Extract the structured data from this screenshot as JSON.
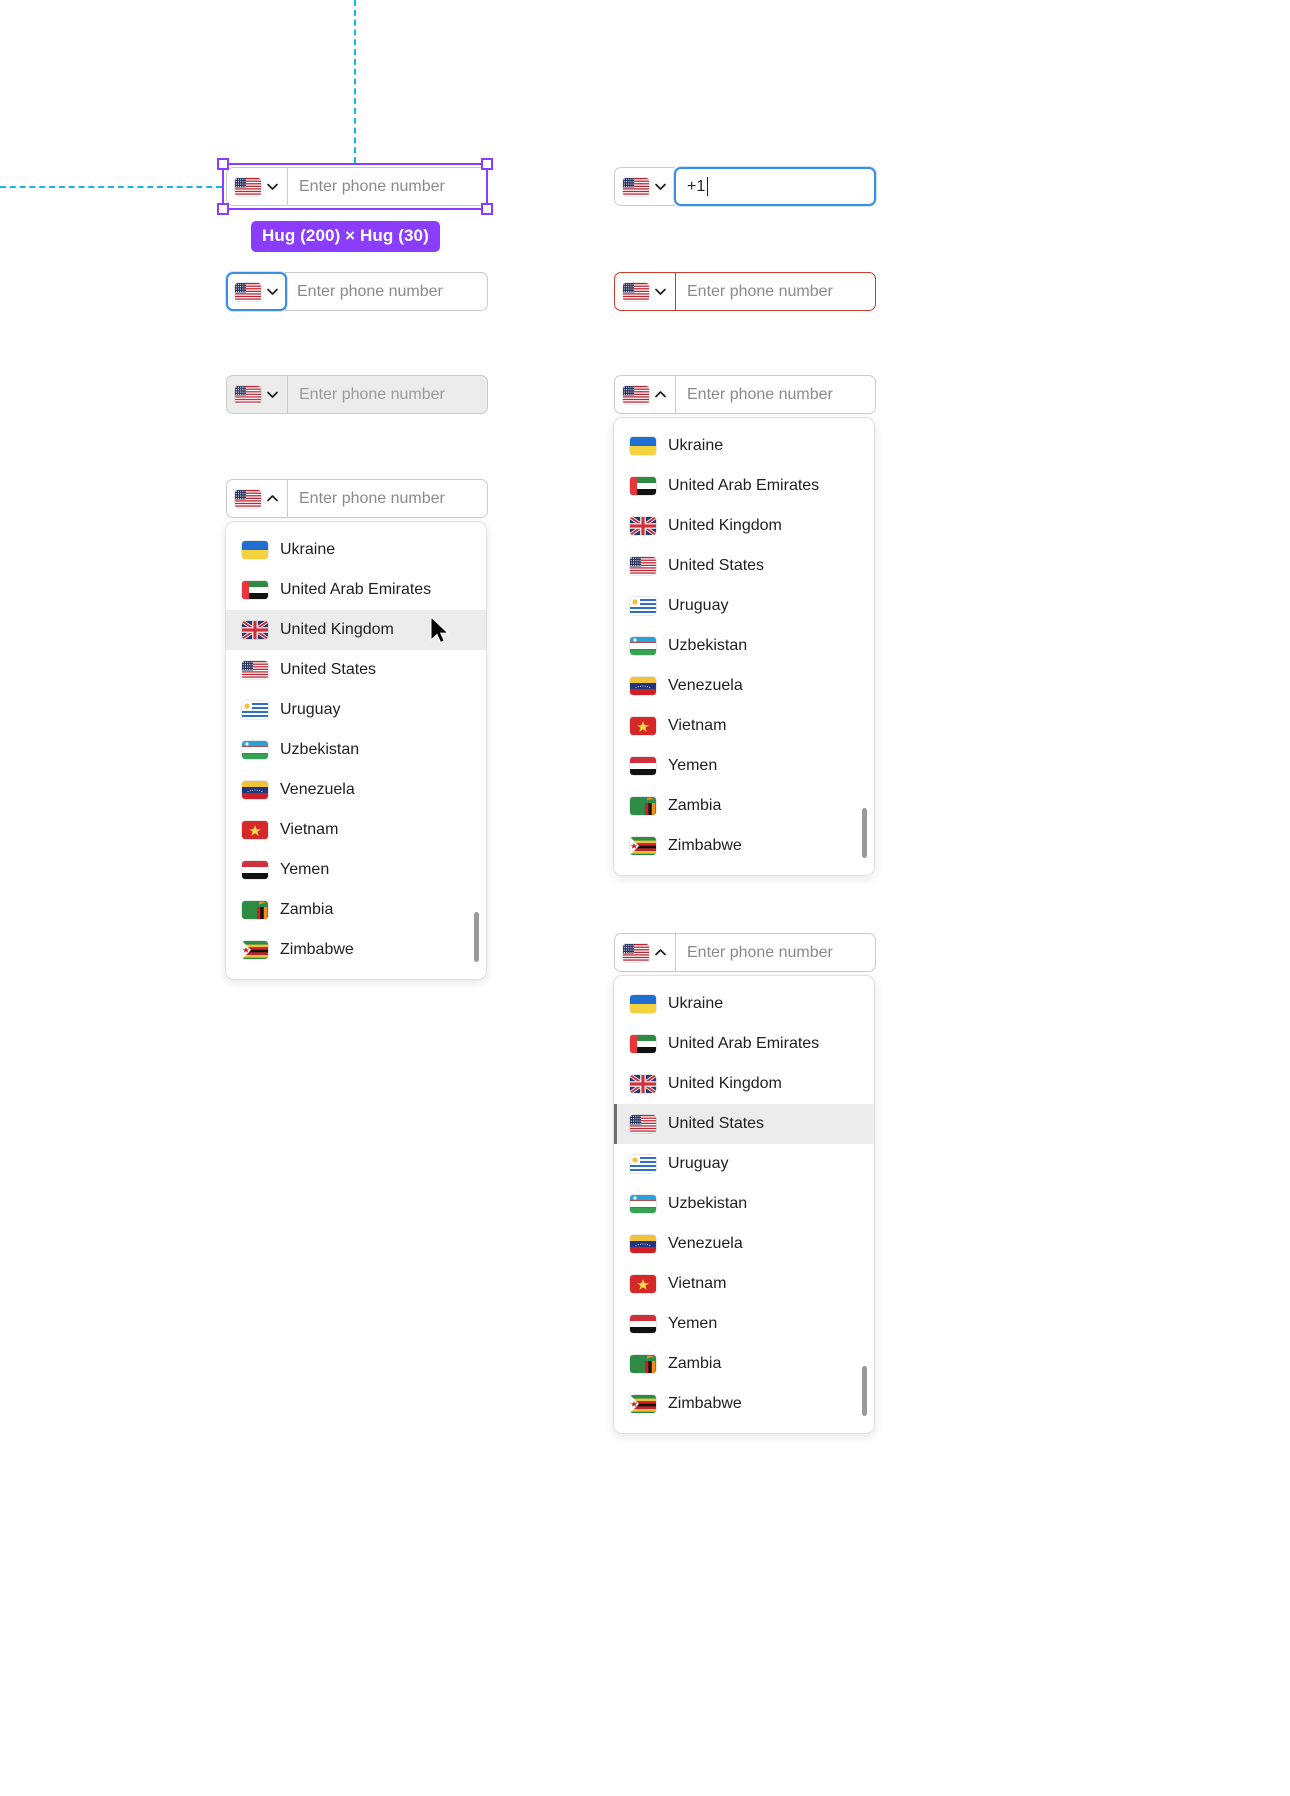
{
  "canvas": {
    "selection_badge": "Hug (200) × Hug (30)",
    "accent_purple": "#8b3dff",
    "guide_blue": "#19b5e8",
    "focus_blue": "#3b8fe0",
    "error_red": "#d03b2b",
    "highlight_grey": "#ececec"
  },
  "placeholder": "Enter phone number",
  "fields": {
    "selected_default": {
      "flag": "flag-us-icon",
      "placeholder": "Enter phone number",
      "chevron": "chevron-down-icon",
      "state": "selected"
    },
    "focus_input": {
      "flag": "flag-us-icon",
      "value": "+1",
      "chevron": "chevron-down-icon",
      "state": "focused-input"
    },
    "focus_select": {
      "flag": "flag-us-icon",
      "placeholder": "Enter phone number",
      "chevron": "chevron-down-icon",
      "state": "focused-select"
    },
    "error": {
      "flag": "flag-us-icon",
      "placeholder": "Enter phone number",
      "chevron": "chevron-down-icon",
      "state": "error"
    },
    "disabled": {
      "flag": "flag-us-icon",
      "placeholder": "Enter phone number",
      "chevron": "chevron-down-icon",
      "state": "disabled"
    },
    "open_left": {
      "flag": "flag-us-icon",
      "placeholder": "Enter phone number",
      "chevron": "chevron-up-icon",
      "state": "open"
    },
    "open_right_top": {
      "flag": "flag-us-icon",
      "placeholder": "Enter phone number",
      "chevron": "chevron-up-icon",
      "state": "open"
    },
    "open_right_bottom": {
      "flag": "flag-us-icon",
      "placeholder": "Enter phone number",
      "chevron": "chevron-up-icon",
      "state": "open"
    }
  },
  "country_list": [
    {
      "flag": "flag-ua-icon",
      "name": "Ukraine"
    },
    {
      "flag": "flag-ae-icon",
      "name": "United Arab Emirates"
    },
    {
      "flag": "flag-gb-icon",
      "name": "United Kingdom"
    },
    {
      "flag": "flag-us-icon",
      "name": "United States"
    },
    {
      "flag": "flag-uy-icon",
      "name": "Uruguay"
    },
    {
      "flag": "flag-uz-icon",
      "name": "Uzbekistan"
    },
    {
      "flag": "flag-ve-icon",
      "name": "Venezuela"
    },
    {
      "flag": "flag-vn-icon",
      "name": "Vietnam"
    },
    {
      "flag": "flag-ye-icon",
      "name": "Yemen"
    },
    {
      "flag": "flag-zm-icon",
      "name": "Zambia"
    },
    {
      "flag": "flag-zw-icon",
      "name": "Zimbabwe"
    }
  ],
  "menus": {
    "left": {
      "hovered": "United Kingdom",
      "hovered_index": 2
    },
    "right_top": {
      "hovered": null,
      "hovered_index": -1
    },
    "right_bottom": {
      "hovered": "United States",
      "hovered_index": 3
    }
  }
}
